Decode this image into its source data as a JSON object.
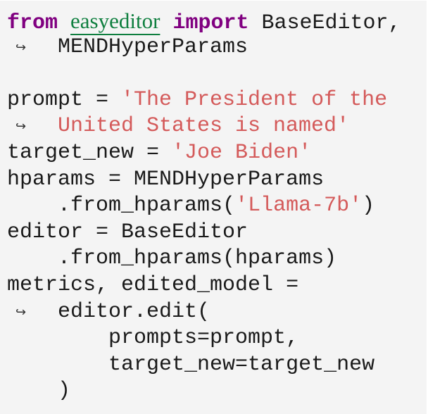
{
  "code": {
    "language": "python",
    "continuation_glyph": "↪",
    "lines": [
      {
        "tokens": [
          {
            "type": "kw",
            "text": "from"
          },
          {
            "type": "plain",
            "text": " "
          },
          {
            "type": "mod",
            "text": "easyeditor"
          },
          {
            "type": "plain",
            "text": " "
          },
          {
            "type": "kw",
            "text": "import"
          },
          {
            "type": "plain",
            "text": " BaseEditor,"
          }
        ]
      },
      {
        "continuation": true,
        "tokens": [
          {
            "type": "plain",
            "text": "MENDHyperParams"
          }
        ]
      },
      {
        "tokens": []
      },
      {
        "tokens": [
          {
            "type": "plain",
            "text": "prompt = "
          },
          {
            "type": "str",
            "text": "'The President of the"
          }
        ]
      },
      {
        "continuation": true,
        "tokens": [
          {
            "type": "str",
            "text": "United States is named'"
          }
        ]
      },
      {
        "tokens": [
          {
            "type": "plain",
            "text": "target_new = "
          },
          {
            "type": "str",
            "text": "'Joe Biden'"
          }
        ]
      },
      {
        "tokens": [
          {
            "type": "plain",
            "text": "hparams = MENDHyperParams"
          }
        ]
      },
      {
        "tokens": [
          {
            "type": "plain",
            "text": "    .from_hparams("
          },
          {
            "type": "str",
            "text": "'Llama-7b'"
          },
          {
            "type": "plain",
            "text": ")"
          }
        ]
      },
      {
        "tokens": [
          {
            "type": "plain",
            "text": "editor = BaseEditor"
          }
        ]
      },
      {
        "tokens": [
          {
            "type": "plain",
            "text": "    .from_hparams(hparams)"
          }
        ]
      },
      {
        "tokens": [
          {
            "type": "plain",
            "text": "metrics, edited_model ="
          }
        ]
      },
      {
        "continuation": true,
        "tokens": [
          {
            "type": "plain",
            "text": "editor.edit("
          }
        ]
      },
      {
        "tokens": [
          {
            "type": "plain",
            "text": "        prompts=prompt,"
          }
        ]
      },
      {
        "tokens": [
          {
            "type": "plain",
            "text": "        target_new=target_new"
          }
        ]
      },
      {
        "tokens": [
          {
            "type": "plain",
            "text": "    )"
          }
        ]
      }
    ]
  },
  "colors": {
    "background": "#f4f4f4",
    "keyword": "#800080",
    "module": "#0f7f3f",
    "string": "#d45a5a",
    "text": "#1a1a1a"
  }
}
